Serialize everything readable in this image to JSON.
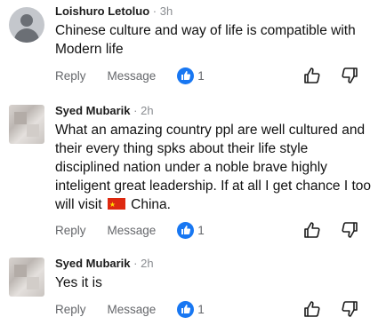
{
  "comments": [
    {
      "author": "Loishuro Letoluo",
      "time": "3h",
      "text": "Chinese culture and way of life is compatible with Modern life",
      "reply_label": "Reply",
      "message_label": "Message",
      "like_count": "1"
    },
    {
      "author": "Syed Mubarik",
      "time": "2h",
      "text_before_flag": "What an amazing country ppl are well cultured and their every thing spks about their life style disciplined nation under a noble brave highly inteligent great leadership. If at all I get chance I too will visit",
      "text_after_flag": "China.",
      "reply_label": "Reply",
      "message_label": "Message",
      "like_count": "1"
    },
    {
      "author": "Syed Mubarik",
      "time": "2h",
      "text": "Yes it is",
      "reply_label": "Reply",
      "message_label": "Message",
      "like_count": "1"
    }
  ],
  "separator": "·",
  "icons": {
    "like_badge": "thumbs-up-icon",
    "upvote": "thumbs-up-outline-icon",
    "downvote": "thumbs-down-outline-icon",
    "flag": "china-flag-icon"
  },
  "colors": {
    "like_blue": "#1877f2",
    "muted": "#65676b",
    "flag_red": "#de2910"
  }
}
